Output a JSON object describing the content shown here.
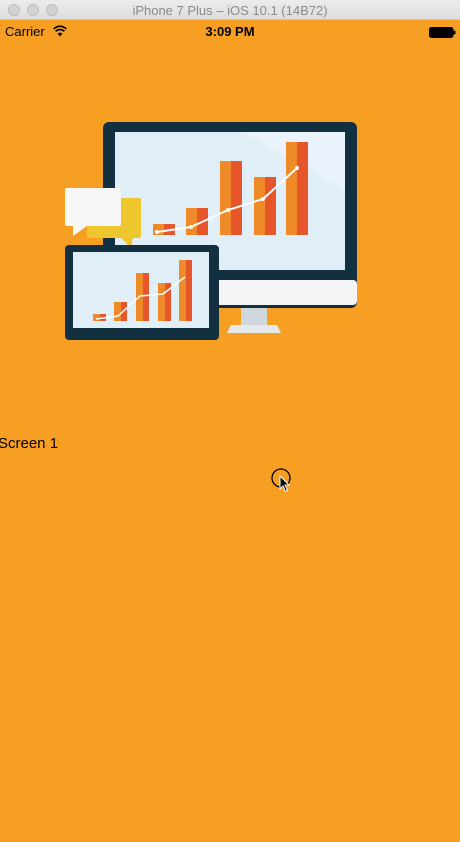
{
  "window": {
    "title": "iPhone 7 Plus – iOS 10.1 (14B72)"
  },
  "status_bar": {
    "carrier": "Carrier",
    "time": "3:09 PM",
    "icons": [
      "wifi-icon",
      "battery-icon"
    ]
  },
  "content": {
    "illustration_icon": "analytics-devices-illustration",
    "screen_label": "Screen 1",
    "background_color": "#f79f22"
  },
  "colors": {
    "monitor_frame": "#12303f",
    "screen": "#e0eef8",
    "bar_orange": "#ee8a28",
    "bar_red": "#e6562a",
    "bubble_white": "#f7f7f7",
    "bubble_yellow": "#eec62d"
  }
}
